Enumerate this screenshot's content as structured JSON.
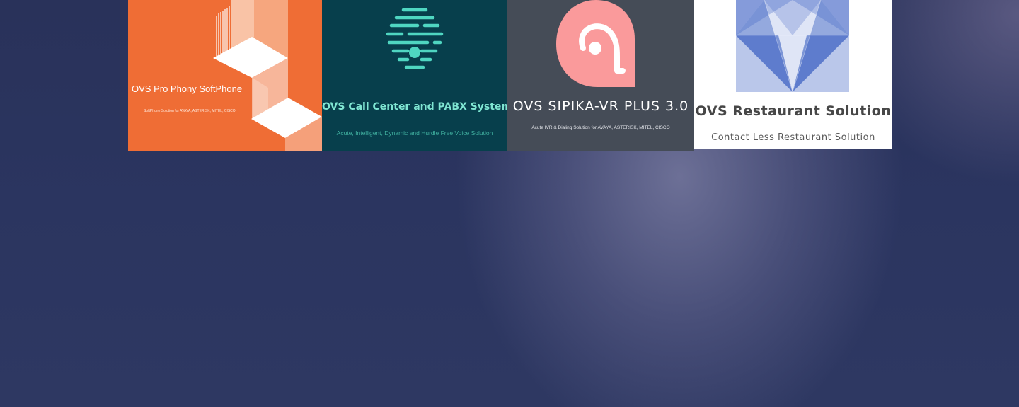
{
  "products": [
    {
      "title": "OVS Pro Phony SoftPhone",
      "subtitle": "SoftPhone Solution for AVAYA, ASTERISK, MITEL, CISCO",
      "logo_icon": "isometric-blocks-icon",
      "background": "#ef6d35"
    },
    {
      "title": "OVS Call Center and PABX System",
      "subtitle": "Acute, Intelligent, Dynamic and Hurdle Free Voice Solution",
      "logo_icon": "beehive-icon",
      "background": "#073f4c"
    },
    {
      "title": "OVS SIPIKA-VR PLUS 3.0",
      "subtitle": "Acute IVR & Dialing Solution for AVAYA, ASTERISK, MITEL, CISCO",
      "logo_icon": "pink-drop-icon",
      "background": "#454c57"
    },
    {
      "title": "OVS Restaurant Solution",
      "subtitle": "Contact Less Restaurant Solution",
      "logo_icon": "blue-geometric-icon",
      "background": "#ffffff"
    }
  ]
}
